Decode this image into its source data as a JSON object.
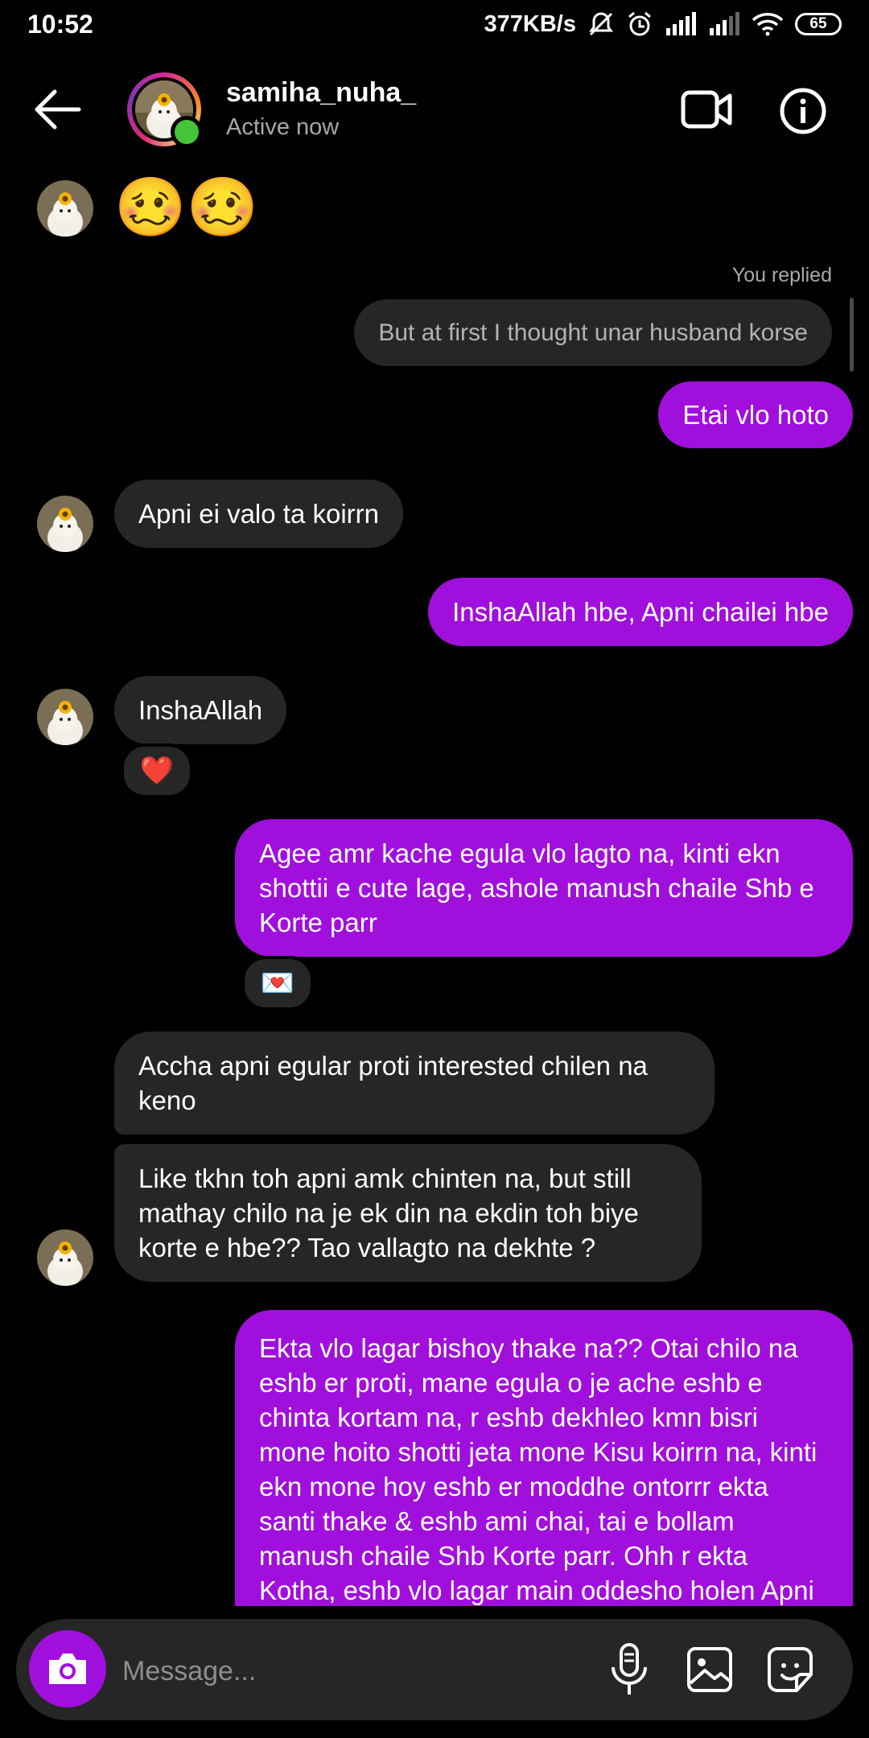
{
  "status_bar": {
    "time": "10:52",
    "network_speed": "377KB/s",
    "battery": "65"
  },
  "header": {
    "username": "samiha_nuha_",
    "presence": "Active now"
  },
  "messages": {
    "emoji_msg": "🥴🥴",
    "replied_label": "You replied",
    "quoted": "But at first I thought unar husband korse",
    "m1": "Etai vlo hoto",
    "m2": "Apni ei valo ta koirrn",
    "m3": "InshaAllah hbe, Apni chailei hbe",
    "m4": "InshaAllah",
    "m4_reaction": "❤️",
    "m5": "Agee amr kache egula vlo lagto na, kinti ekn shottii e cute lage, ashole manush chaile Shb e Korte parr",
    "m5_reaction": "💌",
    "m6": "Accha apni egular proti interested chilen na keno",
    "m7": "Like tkhn toh apni amk chinten na, but still mathay chilo na je ek din na ekdin toh biye korte e hbe??  Tao vallagto na dekhte ?",
    "m8": "Ekta vlo lagar bishoy thake na?? Otai chilo na eshb er proti, mane egula o je ache eshb e chinta kortam na, r eshb dekhleo kmn bisri mone hoito shotti jeta mone Kisu koirrn na, kinti ekn mone hoy eshb er moddhe ontorrr ekta santi thake & eshb ami chai, tai e bollam manush chaile Shb Korte parr. Ohh r ekta Kotha, eshb vlo lagar main oddesho holen Apni apnr Jonno ekn amr vlo lage. Apni"
  },
  "composer": {
    "placeholder": "Message..."
  },
  "colors": {
    "outgoing_bubble": "#a10fdc",
    "incoming_bubble": "#262626",
    "online": "#45c33a"
  },
  "icons": [
    "back-arrow-icon",
    "video-call-icon",
    "info-icon",
    "camera-icon",
    "mic-icon",
    "gallery-icon",
    "sticker-icon",
    "heart-icon",
    "love-letter-icon"
  ]
}
